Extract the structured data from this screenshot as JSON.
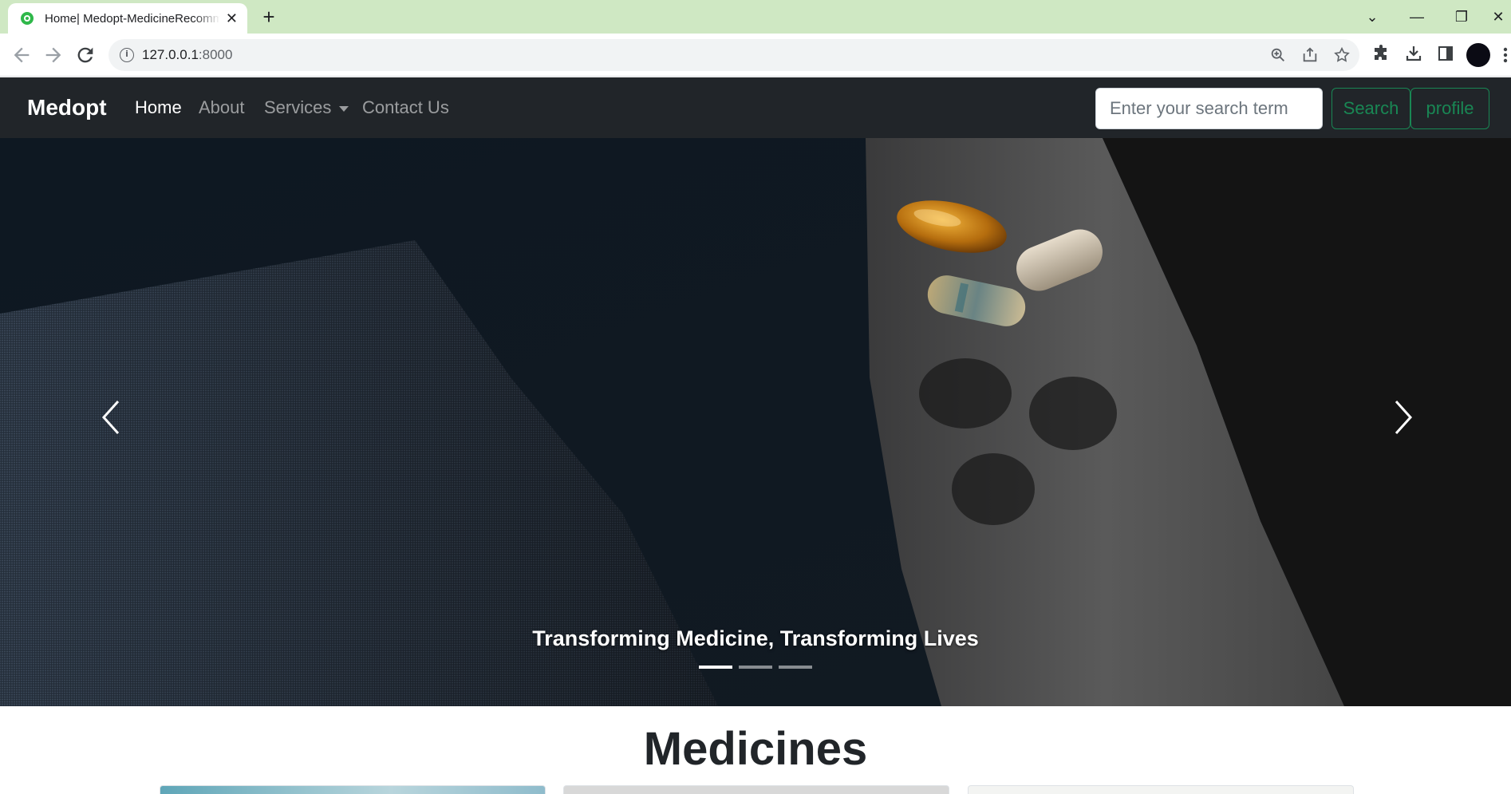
{
  "browser": {
    "tab_title": "Home| Medopt-MedicineRecommendation",
    "tab_close": "✕",
    "new_tab": "+",
    "url_host": "127.0.0.1",
    "url_port": ":8000",
    "window_controls": {
      "tabs_list": "⌄",
      "minimize": "—",
      "restore": "❐",
      "close": "✕"
    },
    "icons": [
      "back-icon",
      "forward-icon",
      "reload-icon",
      "site-info-icon",
      "zoom-icon",
      "share-icon",
      "bookmark-star-icon",
      "extensions-icon",
      "download-icon",
      "side-panel-icon",
      "profile-avatar",
      "menu-icon"
    ]
  },
  "navbar": {
    "brand": "Medopt",
    "links": [
      {
        "label": "Home",
        "active": true
      },
      {
        "label": "About",
        "active": false
      },
      {
        "label": "Services",
        "active": false,
        "dropdown": true
      },
      {
        "label": "Contact Us",
        "active": false
      }
    ],
    "search": {
      "placeholder": "Enter your search term",
      "value": ""
    },
    "search_button": "Search",
    "profile_button": "profile",
    "colors": {
      "background": "#212529",
      "accent": "#198754"
    }
  },
  "carousel": {
    "caption": "Transforming Medicine, Transforming Lives",
    "slide_count": 3,
    "active_slide": 1,
    "prev_icon": "chevron-left-icon",
    "next_icon": "chevron-right-icon"
  },
  "medicines": {
    "title": "Medicines",
    "card_count": 3
  }
}
